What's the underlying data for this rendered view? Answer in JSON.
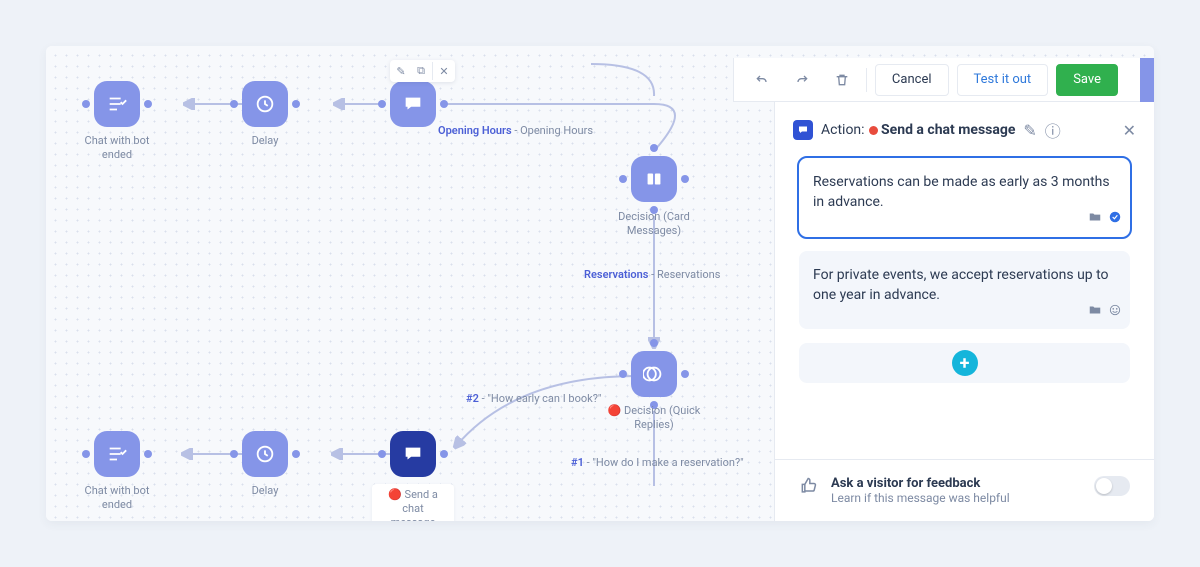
{
  "toolbar": {
    "cancel": "Cancel",
    "test": "Test it out",
    "save": "Save"
  },
  "flow": {
    "top_row": {
      "chat_ended": "Chat with bot ended",
      "delay": "Delay"
    },
    "decision_card": "Decision (Card Messages)",
    "opening_hours": {
      "key": "Opening Hours",
      "val": "Opening Hours"
    },
    "reservations_label": {
      "key": "Reservations",
      "val": "Reservations"
    },
    "quick_replies": "Decision (Quick Replies)",
    "send_chat": "Send a chat message",
    "branch2": {
      "key": "#2",
      "val": "\"How early can I book?\""
    },
    "branch1": {
      "key": "#1",
      "val": "\"How do I make a reservation?\""
    },
    "bottom_row": {
      "chat_ended": "Chat with bot ended",
      "delay": "Delay"
    }
  },
  "panel": {
    "prefix": "Action:",
    "title": "Send a chat message",
    "messages": [
      "Reservations can be made as early as 3 months in advance.",
      "For private events, we accept reservations up to one year in advance."
    ],
    "feedback_title": "Ask a visitor for feedback",
    "feedback_sub": "Learn if this message was helpful"
  }
}
